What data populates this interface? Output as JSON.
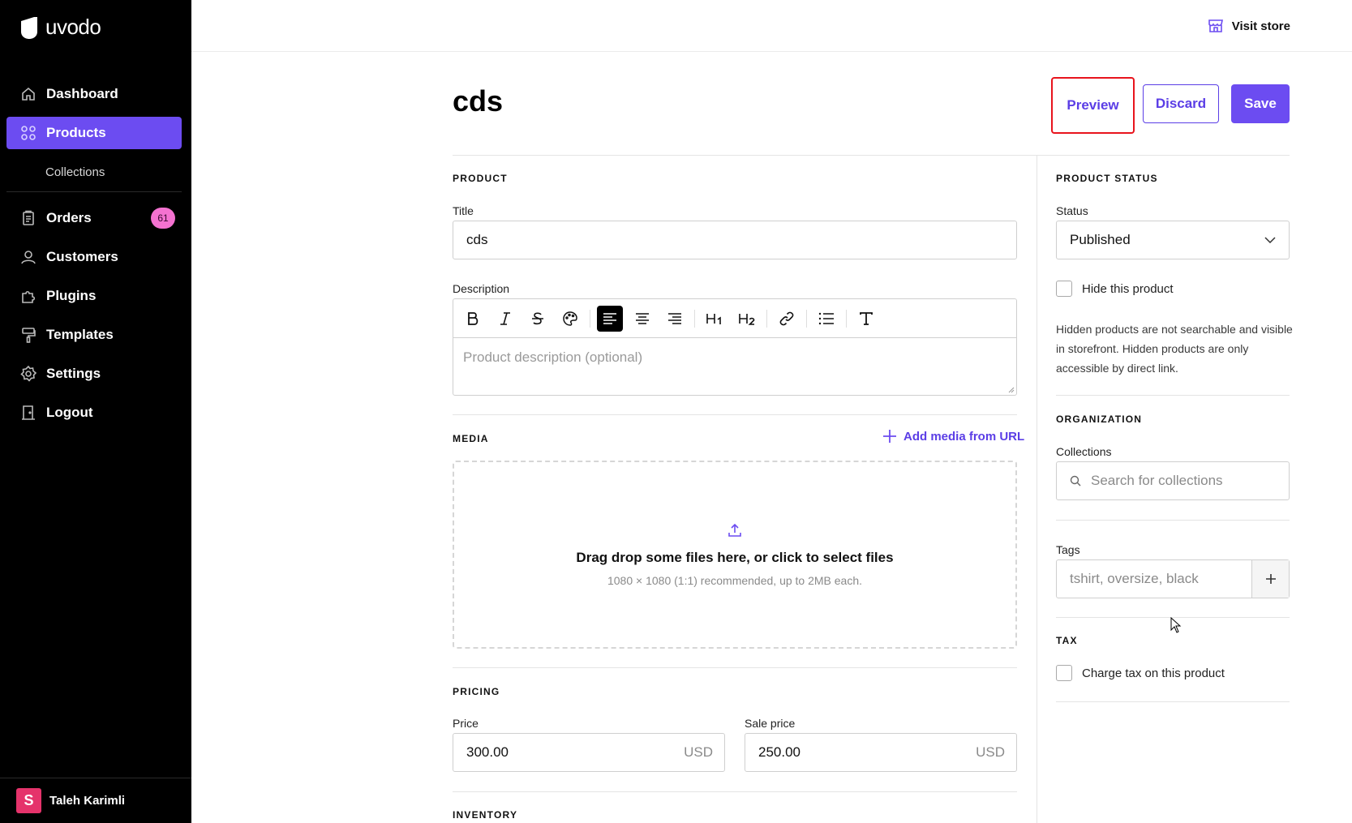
{
  "brand": {
    "name": "uvodo",
    "accent": "#6c4cf1",
    "badge_color": "#f472d0",
    "highlight_border": "#e8141d"
  },
  "sidebar": {
    "items": [
      {
        "label": "Dashboard",
        "icon": "home-icon"
      },
      {
        "label": "Products",
        "icon": "grid-icon",
        "active": true
      },
      {
        "label": "Orders",
        "icon": "clipboard-icon",
        "badge": "61"
      },
      {
        "label": "Customers",
        "icon": "user-icon"
      },
      {
        "label": "Plugins",
        "icon": "puzzle-icon"
      },
      {
        "label": "Templates",
        "icon": "paint-roller-icon"
      },
      {
        "label": "Settings",
        "icon": "gear-icon"
      },
      {
        "label": "Logout",
        "icon": "door-icon"
      }
    ],
    "sub_items": [
      {
        "label": "Collections"
      }
    ],
    "user": {
      "name": "Taleh Karimli",
      "avatar_letter": "S"
    }
  },
  "topbar": {
    "visit_store": "Visit store"
  },
  "page": {
    "title": "cds",
    "buttons": {
      "preview": "Preview",
      "discard": "Discard",
      "save": "Save"
    }
  },
  "product": {
    "section": "PRODUCT",
    "title_label": "Title",
    "title_value": "cds",
    "description_label": "Description",
    "description_placeholder": "Product description (optional)"
  },
  "media": {
    "section": "MEDIA",
    "add_url": "Add media from URL",
    "drop_title": "Drag drop some files here, or click to select files",
    "drop_sub": "1080 × 1080 (1:1) recommended, up to 2MB each."
  },
  "pricing": {
    "section": "PRICING",
    "price_label": "Price",
    "price_value": "300.00",
    "sale_label": "Sale price",
    "sale_value": "250.00",
    "currency": "USD"
  },
  "inventory": {
    "section": "INVENTORY"
  },
  "status": {
    "section": "PRODUCT STATUS",
    "label": "Status",
    "value": "Published",
    "hide_label": "Hide this product",
    "helper": "Hidden products are not searchable and visible in storefront. Hidden products are only accessible by direct link."
  },
  "organization": {
    "section": "ORGANIZATION",
    "collections_label": "Collections",
    "collections_placeholder": "Search for collections",
    "tags_label": "Tags",
    "tags_placeholder": "tshirt, oversize, black"
  },
  "tax": {
    "section": "TAX",
    "charge_label": "Charge tax on this product"
  }
}
